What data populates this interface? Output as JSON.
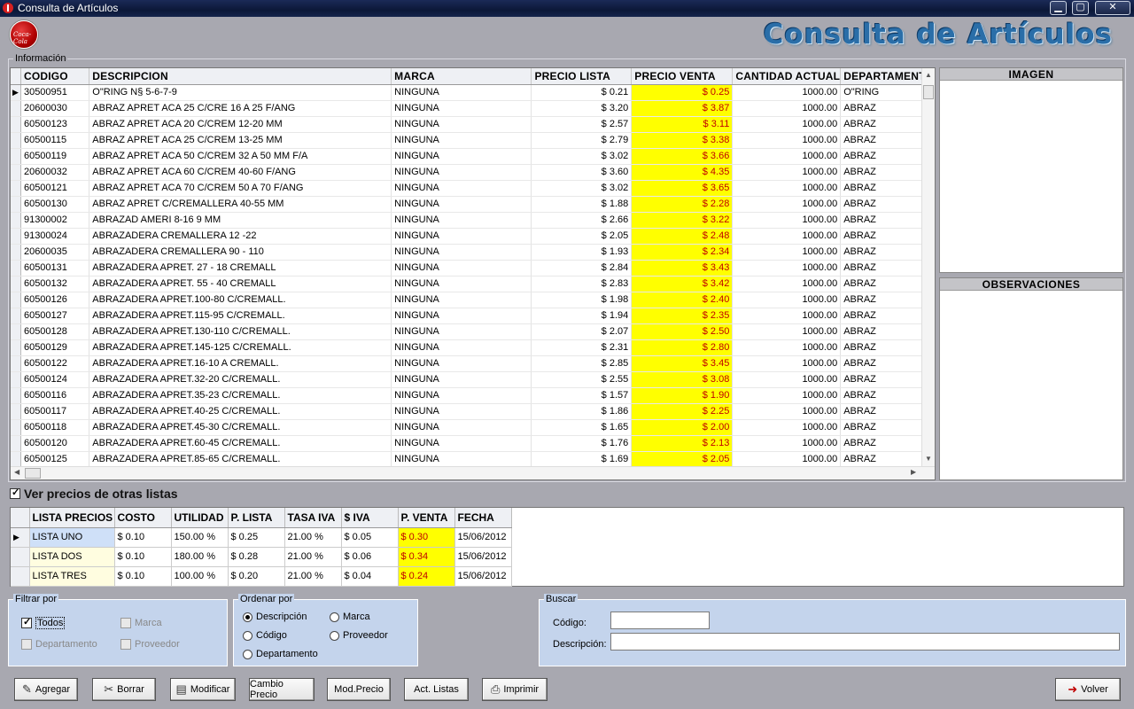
{
  "window": {
    "title": "Consulta de Artículos",
    "min": "▁",
    "max": "▢",
    "close": "✕"
  },
  "header": {
    "logo_text": "Coca-Cola",
    "title": "Consulta de Artículos"
  },
  "info": {
    "legend": "Información"
  },
  "grid": {
    "columns": [
      "CODIGO",
      "DESCRIPCION",
      "MARCA",
      "PRECIO LISTA",
      "PRECIO VENTA",
      "CANTIDAD ACTUAL",
      "DEPARTAMENTO"
    ],
    "rows": [
      [
        "30500951",
        "O\"RING N§ 5-6-7-9",
        "NINGUNA",
        "$ 0.21",
        "$ 0.25",
        "1000.00",
        "O\"RING"
      ],
      [
        "20600030",
        "ABRAZ  APRET ACA 25  C/CRE 16 A 25 F/ANG",
        "NINGUNA",
        "$ 3.20",
        "$ 3.87",
        "1000.00",
        "ABRAZ"
      ],
      [
        "60500123",
        "ABRAZ APRET ACA 20 C/CREM 12-20 MM",
        "NINGUNA",
        "$ 2.57",
        "$ 3.11",
        "1000.00",
        "ABRAZ"
      ],
      [
        "60500115",
        "ABRAZ APRET ACA 25 C/CREM 13-25 MM",
        "NINGUNA",
        "$ 2.79",
        "$ 3.38",
        "1000.00",
        "ABRAZ"
      ],
      [
        "60500119",
        "ABRAZ APRET ACA 50 C/CREM 32 A 50 MM F/A",
        "NINGUNA",
        "$ 3.02",
        "$ 3.66",
        "1000.00",
        "ABRAZ"
      ],
      [
        "20600032",
        "ABRAZ APRET ACA 60 C/CREM 40-60 F/ANG",
        "NINGUNA",
        "$ 3.60",
        "$ 4.35",
        "1000.00",
        "ABRAZ"
      ],
      [
        "60500121",
        "ABRAZ APRET ACA 70 C/CREM 50 A 70 F/ANG",
        "NINGUNA",
        "$ 3.02",
        "$ 3.65",
        "1000.00",
        "ABRAZ"
      ],
      [
        "60500130",
        "ABRAZ APRET C/CREMALLERA  40-55 MM",
        "NINGUNA",
        "$ 1.88",
        "$ 2.28",
        "1000.00",
        "ABRAZ"
      ],
      [
        "91300002",
        "ABRAZAD AMERI 8-16   9 MM",
        "NINGUNA",
        "$ 2.66",
        "$ 3.22",
        "1000.00",
        "ABRAZ"
      ],
      [
        "91300024",
        "ABRAZADERA  CREMALLERA 12 -22",
        "NINGUNA",
        "$ 2.05",
        "$ 2.48",
        "1000.00",
        "ABRAZ"
      ],
      [
        "20600035",
        "ABRAZADERA  CREMALLERA 90 - 110",
        "NINGUNA",
        "$ 1.93",
        "$ 2.34",
        "1000.00",
        "ABRAZ"
      ],
      [
        "60500131",
        "ABRAZADERA APRET.  27 - 18 CREMALL",
        "NINGUNA",
        "$ 2.84",
        "$ 3.43",
        "1000.00",
        "ABRAZ"
      ],
      [
        "60500132",
        "ABRAZADERA APRET.  55 - 40 CREMALL",
        "NINGUNA",
        "$ 2.83",
        "$ 3.42",
        "1000.00",
        "ABRAZ"
      ],
      [
        "60500126",
        "ABRAZADERA APRET.100-80 C/CREMALL.",
        "NINGUNA",
        "$ 1.98",
        "$ 2.40",
        "1000.00",
        "ABRAZ"
      ],
      [
        "60500127",
        "ABRAZADERA APRET.115-95 C/CREMALL.",
        "NINGUNA",
        "$ 1.94",
        "$ 2.35",
        "1000.00",
        "ABRAZ"
      ],
      [
        "60500128",
        "ABRAZADERA APRET.130-110 C/CREMALL.",
        "NINGUNA",
        "$ 2.07",
        "$ 2.50",
        "1000.00",
        "ABRAZ"
      ],
      [
        "60500129",
        "ABRAZADERA APRET.145-125 C/CREMALL.",
        "NINGUNA",
        "$ 2.31",
        "$ 2.80",
        "1000.00",
        "ABRAZ"
      ],
      [
        "60500122",
        "ABRAZADERA APRET.16-10 A CREMALL.",
        "NINGUNA",
        "$ 2.85",
        "$ 3.45",
        "1000.00",
        "ABRAZ"
      ],
      [
        "60500124",
        "ABRAZADERA APRET.32-20 C/CREMALL.",
        "NINGUNA",
        "$ 2.55",
        "$ 3.08",
        "1000.00",
        "ABRAZ"
      ],
      [
        "60500116",
        "ABRAZADERA APRET.35-23 C/CREMALL.",
        "NINGUNA",
        "$ 1.57",
        "$ 1.90",
        "1000.00",
        "ABRAZ"
      ],
      [
        "60500117",
        "ABRAZADERA APRET.40-25 C/CREMALL.",
        "NINGUNA",
        "$ 1.86",
        "$ 2.25",
        "1000.00",
        "ABRAZ"
      ],
      [
        "60500118",
        "ABRAZADERA APRET.45-30 C/CREMALL.",
        "NINGUNA",
        "$ 1.65",
        "$ 2.00",
        "1000.00",
        "ABRAZ"
      ],
      [
        "60500120",
        "ABRAZADERA APRET.60-45 C/CREMALL.",
        "NINGUNA",
        "$ 1.76",
        "$ 2.13",
        "1000.00",
        "ABRAZ"
      ],
      [
        "60500125",
        "ABRAZADERA APRET.85-65 C/CREMALL.",
        "NINGUNA",
        "$ 1.69",
        "$ 2.05",
        "1000.00",
        "ABRAZ"
      ]
    ]
  },
  "panels": {
    "imagen": "IMAGEN",
    "observaciones": "OBSERVACIONES"
  },
  "other_prices": {
    "label": "Ver precios de otras listas",
    "checked": true
  },
  "price_lists": {
    "columns": [
      "LISTA PRECIOS",
      "COSTO",
      "UTILIDAD",
      "P. LISTA",
      "TASA IVA",
      "$ IVA",
      "P. VENTA",
      "FECHA"
    ],
    "rows": [
      [
        "LISTA UNO",
        "$ 0.10",
        "150.00 %",
        "$ 0.25",
        "21.00 %",
        "$ 0.05",
        "$ 0.30",
        "15/06/2012"
      ],
      [
        "LISTA DOS",
        "$ 0.10",
        "180.00 %",
        "$ 0.28",
        "21.00 %",
        "$ 0.06",
        "$ 0.34",
        "15/06/2012"
      ],
      [
        "LISTA TRES",
        "$ 0.10",
        "100.00 %",
        "$ 0.20",
        "21.00 %",
        "$ 0.04",
        "$ 0.24",
        "15/06/2012"
      ]
    ]
  },
  "filter": {
    "legend": "Filtrar por",
    "todos": "Todos",
    "marca": "Marca",
    "departamento": "Departamento",
    "proveedor": "Proveedor"
  },
  "order": {
    "legend": "Ordenar por",
    "descripcion": "Descripción",
    "marca": "Marca",
    "codigo": "Código",
    "proveedor": "Proveedor",
    "departamento": "Departamento"
  },
  "search": {
    "legend": "Buscar",
    "codigo_label": "Código:",
    "codigo_value": "",
    "descripcion_label": "Descripción:",
    "descripcion_value": ""
  },
  "buttons": {
    "agregar": "Agregar",
    "borrar": "Borrar",
    "modificar": "Modificar",
    "cambio_precio": "Cambio Precio",
    "mod_precio": "Mod.Precio",
    "act_listas": "Act. Listas",
    "imprimir": "Imprimir",
    "volver": "Volver"
  }
}
